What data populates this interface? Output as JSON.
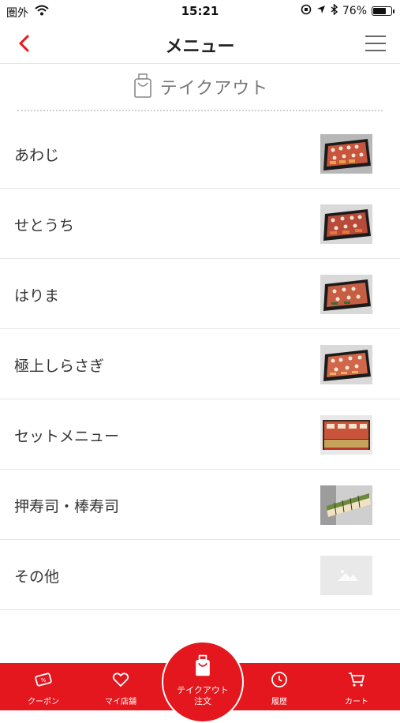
{
  "status_bar": {
    "carrier": "圏外",
    "time": "15:21",
    "battery": "76%",
    "battery_level": 0.76
  },
  "nav": {
    "title": "メニュー"
  },
  "section": {
    "label": "テイクアウト"
  },
  "menu_items": [
    {
      "label": "あわじ",
      "thumb": "sushi-platter"
    },
    {
      "label": "せとうち",
      "thumb": "sushi-platter"
    },
    {
      "label": "はりま",
      "thumb": "sushi-platter"
    },
    {
      "label": "極上しらさぎ",
      "thumb": "sushi-platter"
    },
    {
      "label": "セットメニュー",
      "thumb": "sushi-set"
    },
    {
      "label": "押寿司・棒寿司",
      "thumb": "bar-sushi"
    },
    {
      "label": "その他",
      "thumb": "placeholder"
    }
  ],
  "tab_bar": {
    "items": [
      {
        "label": "クーポン",
        "icon": "coupon-icon"
      },
      {
        "label": "マイ店舗",
        "icon": "heart-icon"
      },
      {
        "label": "テイクアウト注文",
        "label_line1": "テイクアウト",
        "label_line2": "注文",
        "icon": "takeout-bag-icon"
      },
      {
        "label": "履歴",
        "icon": "clock-icon"
      },
      {
        "label": "カート",
        "icon": "cart-icon"
      }
    ]
  },
  "colors": {
    "accent": "#e3171d",
    "text": "#333333",
    "divider": "#e6e6e6"
  }
}
